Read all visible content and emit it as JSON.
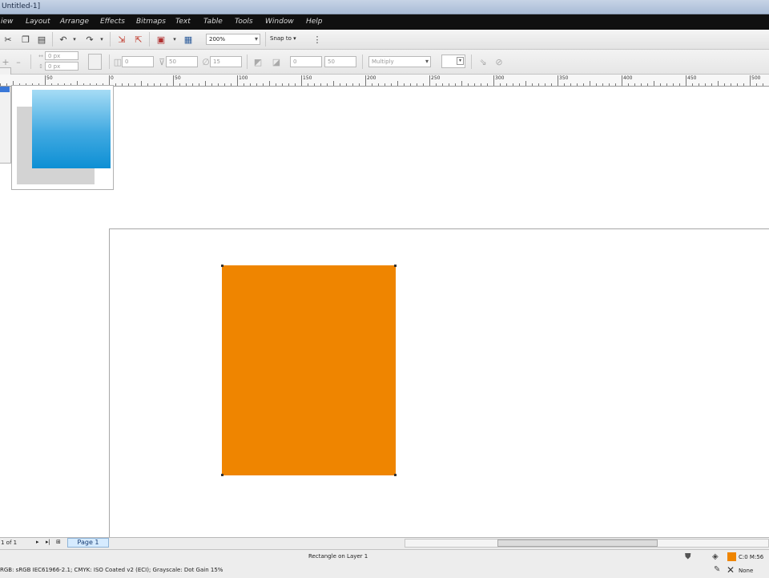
{
  "window": {
    "title": "Untitled-1]"
  },
  "menu": [
    {
      "label": "iew"
    },
    {
      "label": "Layout"
    },
    {
      "label": "Arrange"
    },
    {
      "label": "Effects"
    },
    {
      "label": "Bitmaps"
    },
    {
      "label": "Text"
    },
    {
      "label": "Table"
    },
    {
      "label": "Tools"
    },
    {
      "label": "Window"
    },
    {
      "label": "Help"
    }
  ],
  "toolbar": {
    "zoom": "200%",
    "snap_to": "Snap to"
  },
  "propbar": {
    "x_offset": "0 px",
    "y_offset": "0 px",
    "f1": "0",
    "f2": "50",
    "f3": "15",
    "f4": "0",
    "f5": "50",
    "blend_mode": "Multiply"
  },
  "ruler": {
    "labels": [
      {
        "label": "50"
      },
      {
        "label": "0"
      },
      {
        "label": "50"
      },
      {
        "label": "100"
      },
      {
        "label": "150"
      },
      {
        "label": "200"
      },
      {
        "label": "250"
      },
      {
        "label": "300"
      },
      {
        "label": "350"
      },
      {
        "label": "400"
      },
      {
        "label": "450"
      },
      {
        "label": "500"
      }
    ]
  },
  "canvas": {
    "rect_color": "#ef8500"
  },
  "preview": {
    "gradient_top": "#a6dcf5",
    "gradient_bottom": "#0d8fd4"
  },
  "pager": {
    "page_count": "1 of 1",
    "page_tab": "Page 1"
  },
  "status": {
    "object_info": "Rectangle on Layer 1",
    "color_profile": "RGB: sRGB IEC61966-2.1; CMYK: ISO Coated v2 (ECI); Grayscale: Dot Gain 15%",
    "fill_label": "C:0 M:56",
    "outline_label": "None"
  }
}
